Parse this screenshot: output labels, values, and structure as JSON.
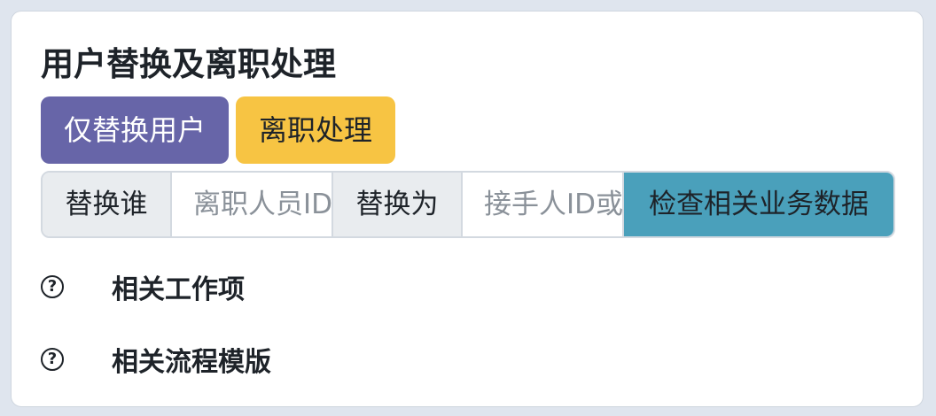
{
  "card": {
    "title": "用户替换及离职处理"
  },
  "actions": {
    "replace_only_label": "仅替换用户",
    "resign_label": "离职处理"
  },
  "input_group": {
    "who_label": "替换谁",
    "who_placeholder": "离职人员ID",
    "to_label": "替换为",
    "to_placeholder": "接手人ID或",
    "check_button_label": "检查相关业务数据"
  },
  "sections": [
    {
      "label": "相关工作项",
      "icon": "question-circle-icon"
    },
    {
      "label": "相关流程模版",
      "icon": "question-circle-icon"
    }
  ],
  "colors": {
    "primary_purple": "#6765a8",
    "warning_yellow": "#f7c443",
    "info_teal": "#4aa0bb",
    "addon_gray": "#e9ecef"
  }
}
